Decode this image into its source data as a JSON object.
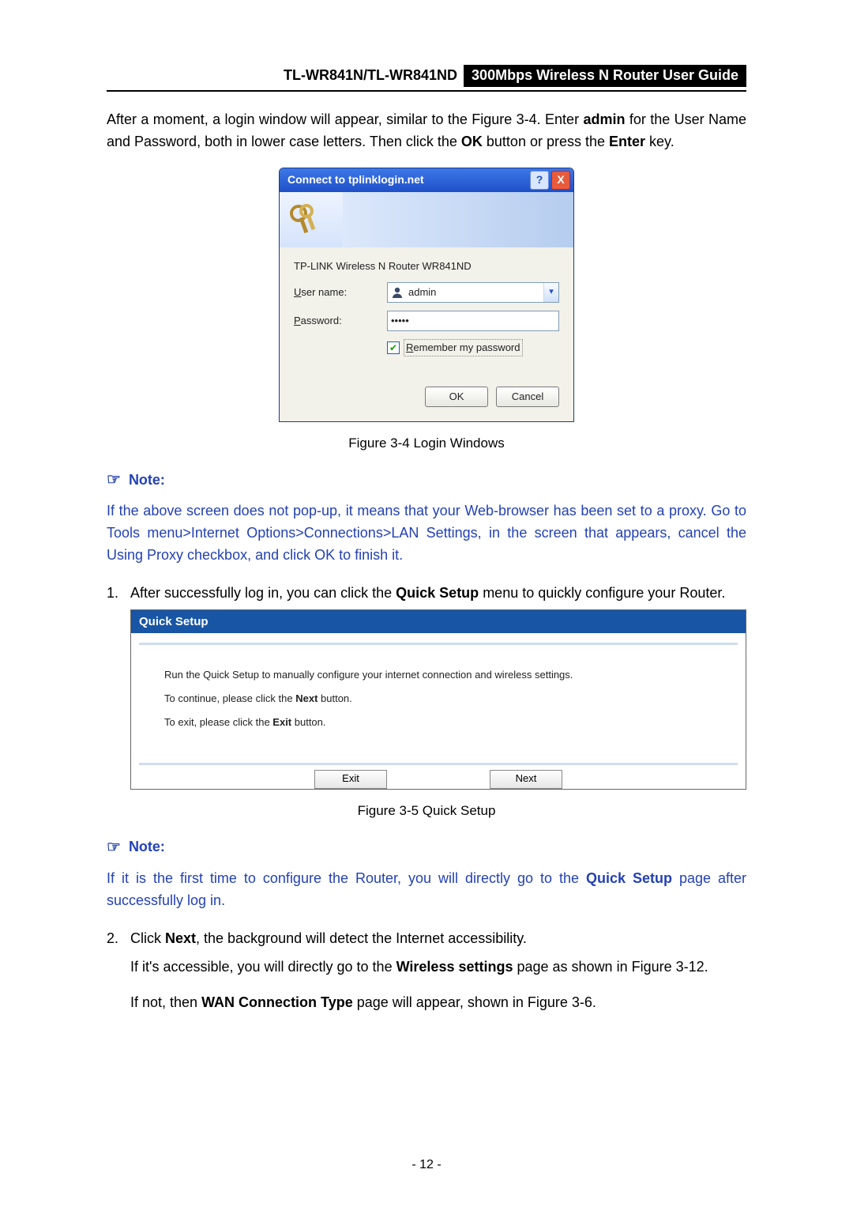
{
  "header": {
    "model": "TL-WR841N/TL-WR841ND",
    "title": "300Mbps Wireless N Router User Guide"
  },
  "intro": {
    "t1": "After a moment, a login window will appear, similar to the Figure 3-4. Enter ",
    "admin": "admin",
    "t2": " for the User Name and Password, both in lower case letters. Then click the ",
    "ok": "OK",
    "t3": " button or press the ",
    "enter": "Enter",
    "t4": " key."
  },
  "login": {
    "title": "Connect to tplinklogin.net",
    "device": "TP-LINK Wireless N Router WR841ND",
    "username_label": "User name:",
    "password_label": "Password:",
    "username_value": "admin",
    "password_value": "•••••",
    "remember": "Remember my password",
    "ok": "OK",
    "cancel": "Cancel",
    "help": "?",
    "close": "X"
  },
  "fig34": "Figure 3-4    Login Windows",
  "note_label": "Note:",
  "note1": "If the above screen does not pop-up, it means that your Web-browser has been set to a proxy. Go to Tools menu>Internet Options>Connections>LAN Settings, in the screen that appears, cancel the Using Proxy checkbox, and click OK to finish it.",
  "step1": {
    "num": "1.",
    "a": "After successfully log in, you can click the ",
    "b": "Quick Setup",
    "c": " menu to quickly configure your Router."
  },
  "quicksetup": {
    "title": "Quick Setup",
    "line1": "Run the Quick Setup to manually configure your internet connection and wireless settings.",
    "line2a": "To continue, please click the ",
    "line2b": "Next",
    "line2c": " button.",
    "line3a": "To exit, please click the ",
    "line3b": "Exit",
    "line3c": "  button.",
    "exit": "Exit",
    "next": "Next"
  },
  "fig35": "Figure 3-5    Quick Setup",
  "note2": {
    "a": "If it is the first time to configure the Router, you will directly go to the ",
    "b": "Quick Setup",
    "c": " page after successfully log in."
  },
  "step2": {
    "num": "2.",
    "a": "Click ",
    "b": "Next",
    "c": ", the background will detect the Internet accessibility."
  },
  "step2_p2": {
    "a": "If it's accessible, you will directly go to the ",
    "b": "Wireless settings",
    "c": " page as shown in Figure 3-12."
  },
  "step2_p3": {
    "a": "If not, then ",
    "b": "WAN Connection Type",
    "c": " page will appear, shown in Figure 3-6."
  },
  "page_number": "- 12 -"
}
